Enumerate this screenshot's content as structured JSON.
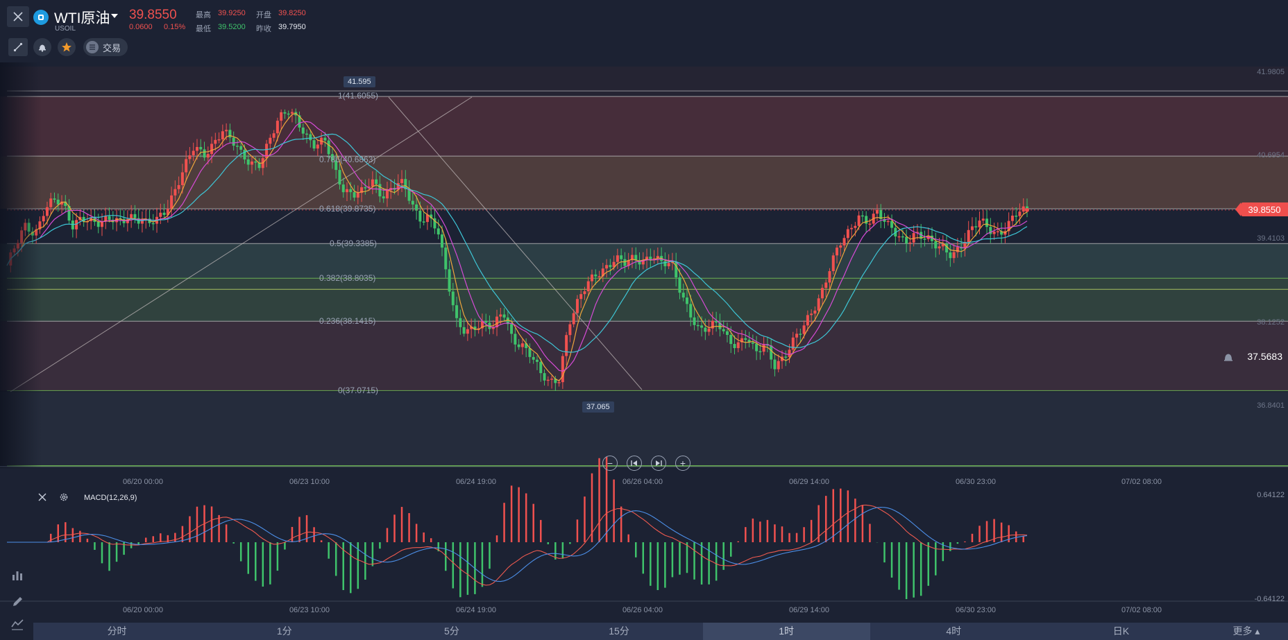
{
  "header": {
    "symbol_name": "WTI原油",
    "symbol_code": "USOIL",
    "last_price": "39.8550",
    "change": "0.0600",
    "change_pct": "0.15%",
    "high_label": "最高",
    "high_value": "39.9250",
    "open_label": "开盘",
    "open_value": "39.8250",
    "low_label": "最低",
    "low_value": "39.5200",
    "prev_close_label": "昨收",
    "prev_close_value": "39.7950",
    "trade_label": "交易",
    "colors": {
      "up": "#f0514f",
      "down": "#3fc36b"
    }
  },
  "price_axis": {
    "ticks": [
      "41.9805",
      "40.6954",
      "39.4103",
      "38.1252",
      "36.8401"
    ],
    "current_price_tag": "39.8550",
    "alert_price": "37.5683"
  },
  "fibonacci": {
    "levels": [
      {
        "label": "1(41.6055)",
        "value": 41.6055
      },
      {
        "label": "0.786(40.6863)",
        "value": 40.6863
      },
      {
        "label": "0.618(39.8735)",
        "value": 39.8735
      },
      {
        "label": "0.5(39.3385)",
        "value": 39.3385
      },
      {
        "label": "0.382(38.8035)",
        "value": 38.8035
      },
      {
        "label": "0.236(38.1415)",
        "value": 38.1415
      },
      {
        "label": "0(37.0715)",
        "value": 37.0715
      }
    ],
    "high_callout": "41.595",
    "low_callout": "37.065"
  },
  "time_axis": {
    "labels": [
      "06/20 00:00",
      "06/23 10:00",
      "06/24 19:00",
      "06/26 04:00",
      "06/29 14:00",
      "06/30 23:00",
      "07/02 08:00"
    ]
  },
  "macd": {
    "name": "MACD(12,26,9)",
    "axis_top": "0.64122",
    "axis_bottom": "-0.64122"
  },
  "timeframes": {
    "items": [
      "分时",
      "1分",
      "5分",
      "15分",
      "1时",
      "4时",
      "日K",
      "更多"
    ],
    "active": "1时"
  },
  "chart_data": {
    "type": "candlestick",
    "symbol": "USOIL",
    "ylim": [
      36.5,
      42.2
    ],
    "anchors": [
      39.0,
      39.3,
      39.6,
      39.5,
      39.9,
      40.0,
      39.9,
      39.6,
      39.8,
      39.7,
      39.6,
      39.7,
      39.7,
      39.8,
      39.7,
      39.6,
      39.7,
      39.9,
      40.2,
      40.5,
      40.8,
      40.7,
      40.9,
      41.1,
      40.9,
      40.7,
      40.6,
      40.6,
      40.9,
      41.2,
      41.4,
      41.3,
      41.0,
      40.8,
      40.9,
      40.5,
      40.2,
      40.1,
      40.1,
      40.3,
      40.1,
      40.2,
      40.3,
      40.0,
      39.7,
      39.8,
      39.6,
      38.8,
      38.1,
      38.0,
      38.1,
      38.1,
      38.0,
      38.3,
      37.9,
      37.8,
      37.6,
      37.3,
      37.2,
      37.3,
      38.1,
      38.4,
      38.7,
      38.9,
      39.0,
      39.1,
      39.0,
      39.1,
      39.1,
      39.2,
      39.0,
      39.0,
      38.6,
      38.3,
      38.0,
      38.0,
      38.1,
      37.9,
      37.8,
      37.9,
      37.6,
      37.8,
      37.5,
      37.6,
      37.8,
      38.0,
      38.3,
      38.6,
      39.0,
      39.3,
      39.5,
      39.8,
      39.7,
      39.8,
      39.6,
      39.5,
      39.4,
      39.5,
      39.4,
      39.3,
      39.3,
      39.2,
      39.3,
      39.5,
      39.7,
      39.6,
      39.5,
      39.6,
      39.8,
      39.86
    ],
    "macd_hist_range": [
      -0.64122,
      0.64122
    ]
  }
}
